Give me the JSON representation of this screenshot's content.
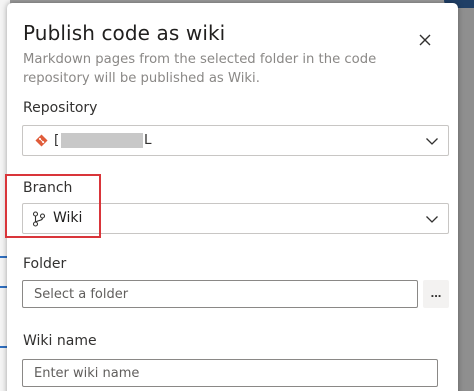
{
  "dialog": {
    "title": "Publish code as wiki",
    "subtitle": "Markdown pages from the selected folder in the code repository will be published as Wiki.",
    "close_icon": "close-icon"
  },
  "repository": {
    "label": "Repository",
    "value_prefix": "[",
    "value_suffix": "L",
    "icon": "git-repo-icon",
    "icon_color": "#e05c3a"
  },
  "branch": {
    "label": "Branch",
    "value": "Wiki",
    "icon": "git-branch-icon",
    "highlight_color": "#d9353a"
  },
  "folder": {
    "label": "Folder",
    "placeholder": "Select a folder",
    "browse_label": "..."
  },
  "wiki_name": {
    "label": "Wiki name",
    "placeholder": "Enter wiki name"
  }
}
